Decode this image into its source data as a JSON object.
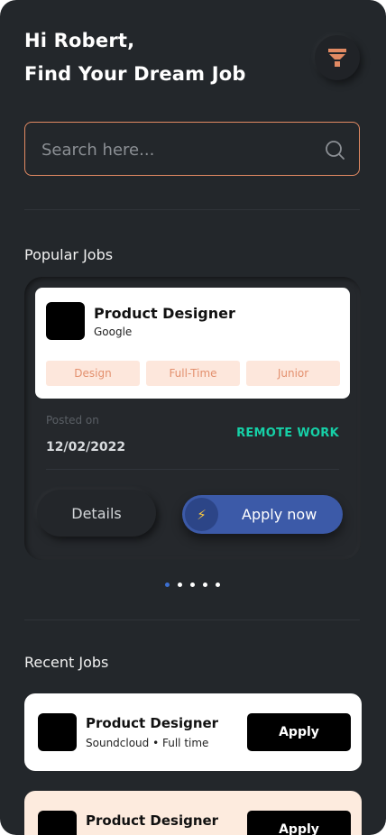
{
  "header": {
    "greeting_line1": "Hi Robert,",
    "greeting_line2": "Find Your Dream Job",
    "filter_icon": "filter-funnel-icon",
    "accent_color": "#e28a63"
  },
  "search": {
    "placeholder": "Search here...",
    "value": "",
    "icon": "search-icon"
  },
  "popular": {
    "section_title": "Popular Jobs",
    "card": {
      "title": "Product Designer",
      "company": "Google",
      "tags": [
        "Design",
        "Full-Time",
        "Junior"
      ],
      "posted_label": "Posted on",
      "posted_date": "12/02/2022",
      "work_type": "REMOTE WORK",
      "details_label": "Details",
      "apply_label": "Apply now",
      "apply_icon": "lightning-bolt-icon"
    },
    "carousel": {
      "total": 5,
      "active_index": 0
    }
  },
  "recent": {
    "section_title": "Recent Jobs",
    "items": [
      {
        "title": "Product Designer",
        "subtitle": "Soundcloud • Full time",
        "apply_label": "Apply",
        "background": "#ffffff"
      },
      {
        "title": "Product Designer",
        "subtitle": "",
        "apply_label": "Apply",
        "background": "#fdebde"
      }
    ]
  }
}
